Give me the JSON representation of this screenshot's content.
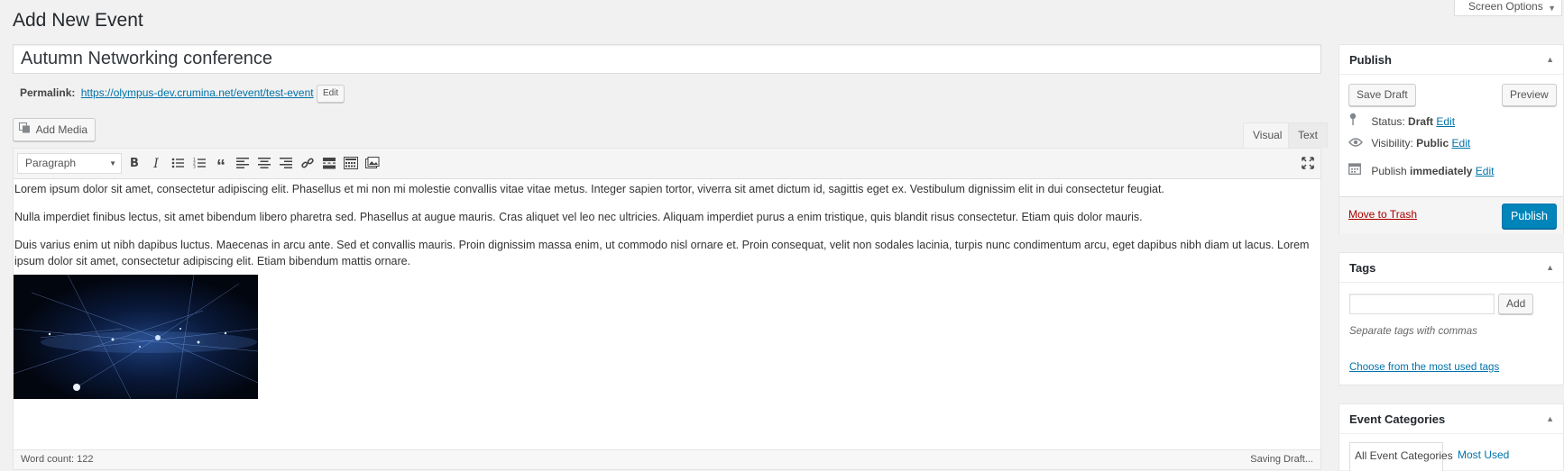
{
  "header": {
    "title": "Add New Event",
    "screen_options": "Screen Options"
  },
  "post": {
    "title": "Autumn Networking conference",
    "permalink_label": "Permalink:",
    "permalink_url": "https://olympus-dev.crumina.net/event/test-event",
    "permalink_edit": "Edit"
  },
  "editor": {
    "add_media": "Add Media",
    "tabs": {
      "visual": "Visual",
      "text": "Text"
    },
    "format": "Paragraph",
    "toolbar_icons": [
      "bold-icon",
      "italic-icon",
      "bullet-list-icon",
      "numbered-list-icon",
      "blockquote-icon",
      "align-left-icon",
      "align-center-icon",
      "align-right-icon",
      "link-icon",
      "read-more-icon",
      "toolbar-toggle-icon",
      "insert-gallery-icon",
      "fullscreen-icon"
    ],
    "paragraphs": [
      "Lorem ipsum dolor sit amet, consectetur adipiscing elit. Phasellus et mi non mi molestie convallis vitae vitae metus. Integer sapien tortor, viverra sit amet dictum id, sagittis eget ex. Vestibulum dignissim elit in dui consectetur feugiat.",
      "Nulla imperdiet finibus lectus, sit amet bibendum libero pharetra sed. Phasellus at augue mauris. Cras aliquet vel leo nec ultricies. Aliquam imperdiet purus a enim tristique, quis blandit risus consectetur. Etiam quis dolor mauris.",
      "Duis varius enim ut nibh dapibus luctus. Maecenas in arcu ante. Sed et convallis mauris. Proin dignissim massa enim, ut commodo nisl ornare et. Proin consequat, velit non sodales lacinia, turpis nunc condimentum arcu, eget dapibus nibh diam ut lacus. Lorem ipsum dolor sit amet, consectetur adipiscing elit. Etiam bibendum mattis ornare."
    ],
    "word_count": "Word count: 122",
    "status": "Saving Draft..."
  },
  "publish": {
    "title": "Publish",
    "save_draft": "Save Draft",
    "preview": "Preview",
    "status_label": "Status:",
    "status_value": "Draft",
    "visibility_label": "Visibility:",
    "visibility_value": "Public",
    "publish_label": "Publish",
    "publish_value": "immediately",
    "edit": "Edit",
    "trash": "Move to Trash",
    "publish_button": "Publish"
  },
  "tags": {
    "title": "Tags",
    "add": "Add",
    "hint": "Separate tags with commas",
    "choose": "Choose from the most used tags"
  },
  "categories": {
    "title": "Event Categories",
    "tab_all": "All Event Categories",
    "tab_used": "Most Used"
  },
  "colors": {
    "link": "#0073aa",
    "primary_button": "#0085ba",
    "trash": "#a00"
  }
}
